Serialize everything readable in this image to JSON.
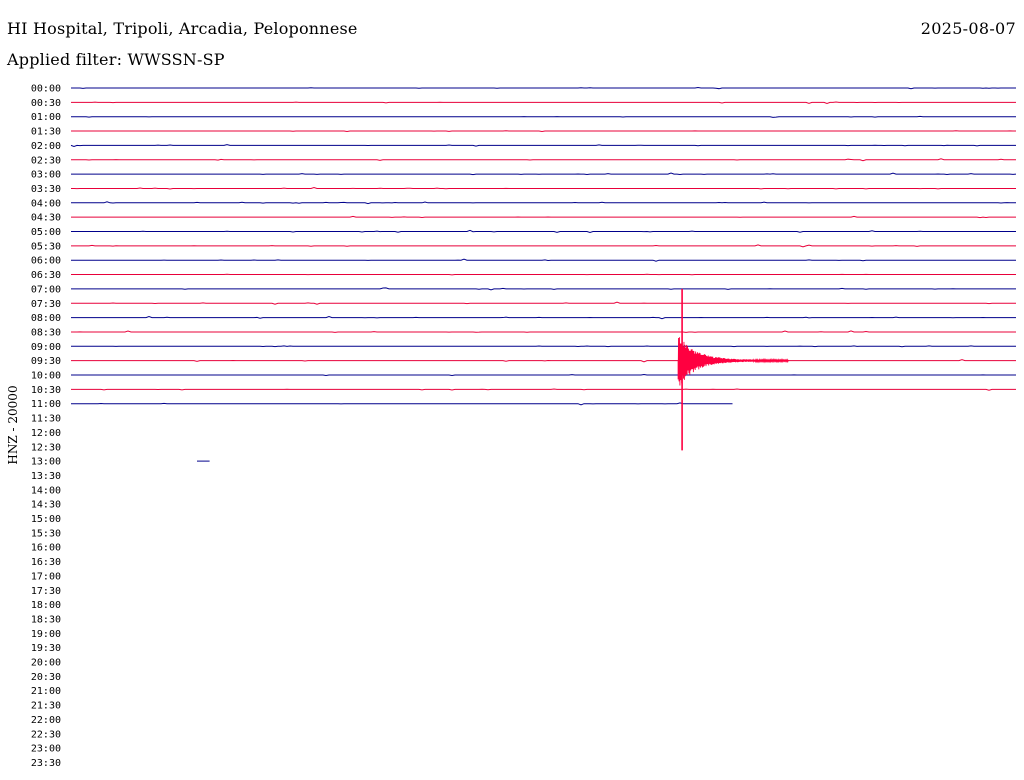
{
  "header": {
    "station_title": "HI Hospital, Tripoli, Arcadia, Peloponnese",
    "date": "2025-08-07",
    "filter_label": "Applied filter: WWSSN-SP"
  },
  "chart_data": {
    "type": "line",
    "subtype": "helicorder",
    "title": "HI Hospital, Tripoli, Arcadia, Peloponnese",
    "date": "2025-08-07",
    "filter": "Applied filter: WWSSN-SP",
    "ylabel": "HNZ - 20000",
    "xlabel": "",
    "grid": false,
    "row_labels": [
      "00:00",
      "00:30",
      "01:00",
      "01:30",
      "02:00",
      "02:30",
      "03:00",
      "03:30",
      "04:00",
      "04:30",
      "05:00",
      "05:30",
      "06:00",
      "06:30",
      "07:00",
      "07:30",
      "08:00",
      "08:30",
      "09:00",
      "09:30",
      "10:00",
      "10:30",
      "11:00",
      "11:30",
      "12:00",
      "12:30",
      "13:00",
      "13:30",
      "14:00",
      "14:30",
      "15:00",
      "15:30",
      "16:00",
      "16:30",
      "17:00",
      "17:30",
      "18:00",
      "18:30",
      "19:00",
      "19:30",
      "20:00",
      "20:30",
      "21:00",
      "21:30",
      "22:00",
      "22:30",
      "23:00",
      "23:30"
    ],
    "row_minutes": 30,
    "recorded_rows": 23,
    "last_row_fraction": 0.7,
    "colors": {
      "even_row": "#00008b",
      "odd_row": "#e8003a",
      "event": "#ff0040"
    },
    "events": [
      {
        "row": "09:30",
        "minute_offset": 19.4,
        "peak_amplitude_rows": 5.0,
        "coda_minutes": 3.5,
        "description": ""
      }
    ],
    "detached_segments": [
      {
        "row": "13:00",
        "start_minute": 4.0,
        "end_minute": 4.4
      }
    ]
  }
}
